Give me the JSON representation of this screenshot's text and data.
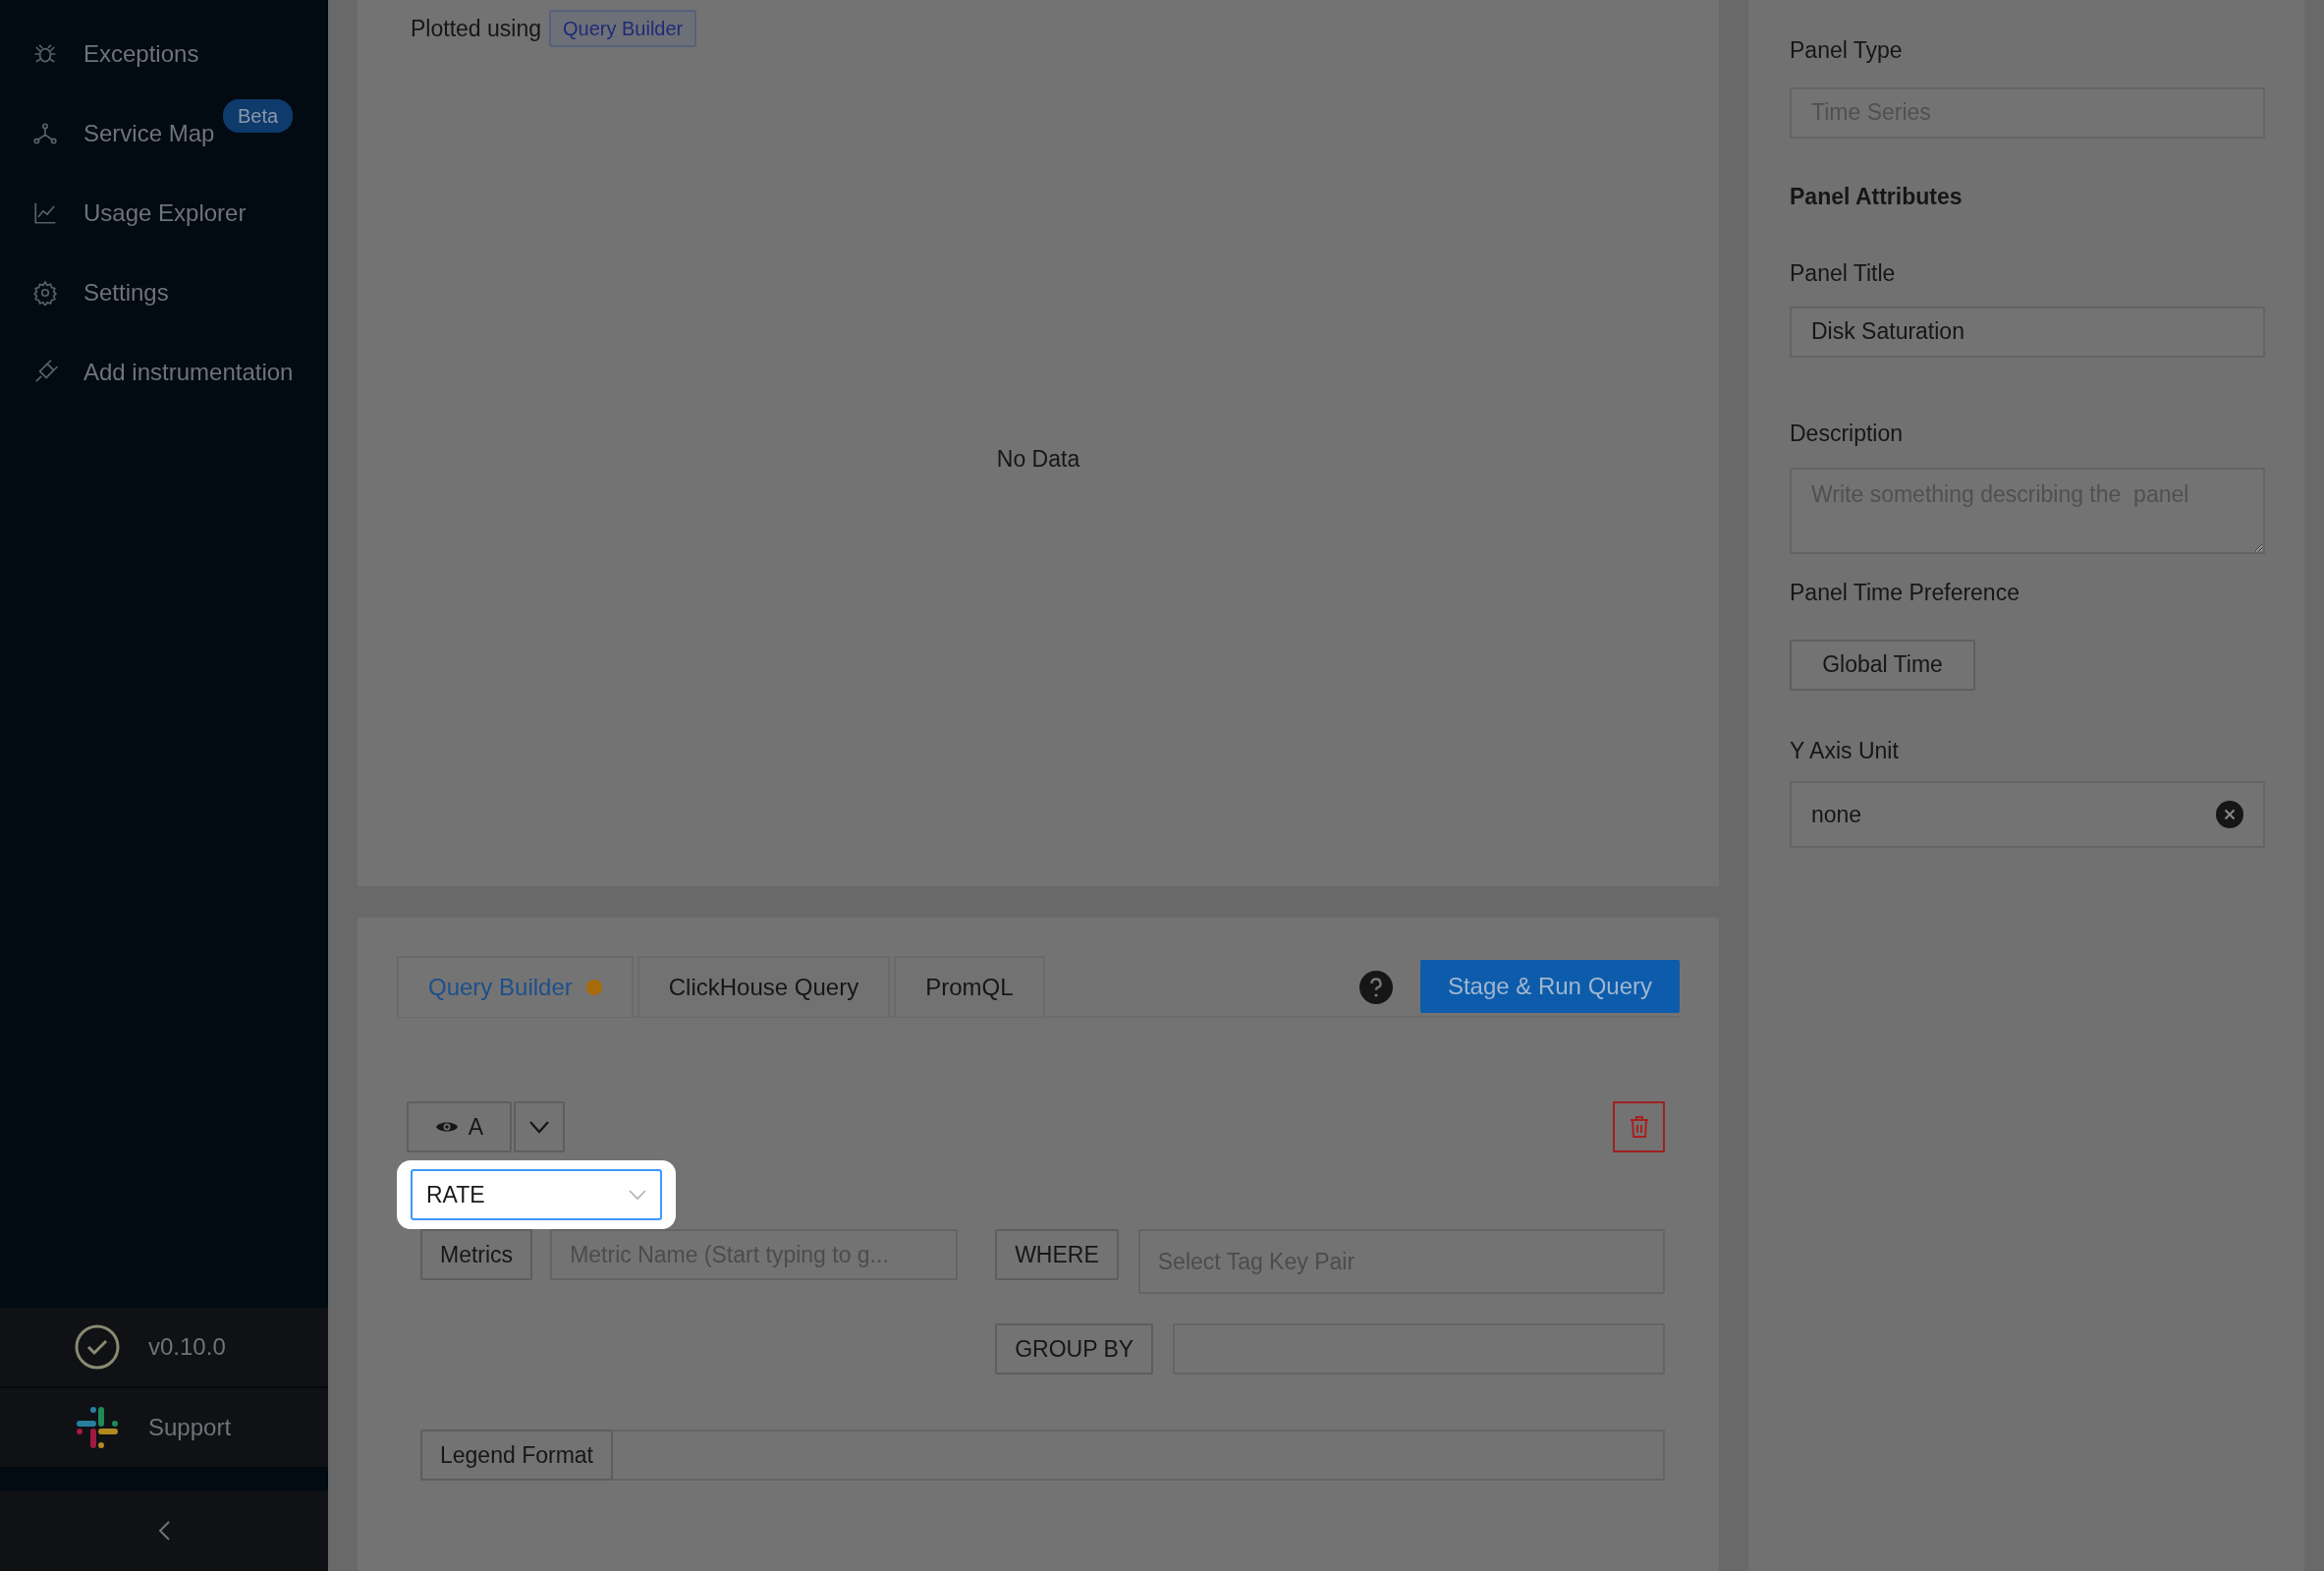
{
  "sidebar": {
    "items": [
      {
        "label": "Exceptions"
      },
      {
        "label": "Service Map",
        "badge": "Beta"
      },
      {
        "label": "Usage Explorer"
      },
      {
        "label": "Settings"
      },
      {
        "label": "Add instrumentation"
      }
    ],
    "version": {
      "label": "v0.10.0"
    },
    "support": {
      "label": "Support"
    }
  },
  "chart": {
    "plotted_using": "Plotted using",
    "query_type": "Query Builder",
    "empty_message": "No Data"
  },
  "query_panel": {
    "tabs": [
      {
        "label": "Query Builder",
        "selected": true,
        "modified": true
      },
      {
        "label": "ClickHouse Query",
        "selected": false,
        "modified": false
      },
      {
        "label": "PromQL",
        "selected": false,
        "modified": false
      }
    ],
    "run_button": "Stage & Run Query",
    "query": {
      "name": "A",
      "aggregate": {
        "value": "RATE",
        "highlighted": true
      },
      "metrics_label": "Metrics",
      "metric_placeholder": "Metric Name (Start typing to g...",
      "where_label": "WHERE",
      "where_placeholder": "Select Tag Key Pair",
      "group_by_label": "GROUP BY",
      "legend_label": "Legend Format"
    }
  },
  "settings": {
    "panel_type_label": "Panel Type",
    "panel_type_placeholder": "Time Series",
    "section_title": "Panel Attributes",
    "title_label": "Panel Title",
    "title_value": "Disk Saturation",
    "description_label": "Description",
    "description_placeholder": "Write something describing the  panel",
    "time_preference_label": "Panel Time Preference",
    "time_preference_value": "Global Time",
    "y_axis_label": "Y Axis Unit",
    "y_axis_value": "none"
  }
}
